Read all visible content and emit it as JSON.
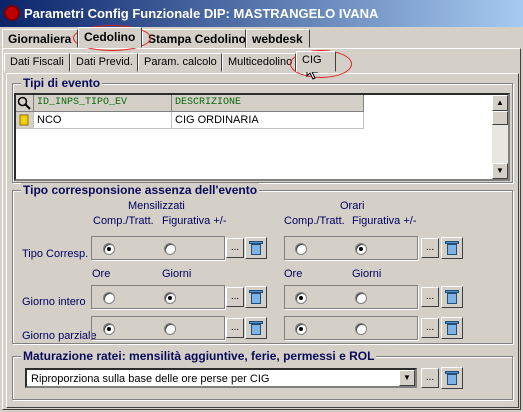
{
  "window": {
    "title": "Parametri Config Funzionale DIP: MASTRANGELO  IVANA"
  },
  "main_tabs": [
    {
      "label": "Giornaliera"
    },
    {
      "label": "Cedolino"
    },
    {
      "label": "Stampa Cedolino"
    },
    {
      "label": "webdesk"
    }
  ],
  "sub_tabs": [
    {
      "label": "Dati Fiscali"
    },
    {
      "label": "Dati Previd."
    },
    {
      "label": "Param. calcolo"
    },
    {
      "label": "Multicedolino"
    },
    {
      "label": "CIG"
    }
  ],
  "tipi_evento": {
    "title": "Tipi di evento",
    "columns": [
      "ID_INPS_TIPO_EV",
      "DESCRIZIONE"
    ],
    "rows": [
      [
        "NCO",
        "CIG ORDINARIA"
      ]
    ]
  },
  "assenza": {
    "title": "Tipo corresponsione assenza dell'evento",
    "mensilizzati": "Mensilizzati",
    "orari": "Orari",
    "comp_tratt": "Comp./Tratt.",
    "figurativa": "Figurativa +/-",
    "ore": "Ore",
    "giorni": "Giorni",
    "tipo_corresp": "Tipo Corresp.",
    "giorno_intero": "Giorno intero",
    "giorno_parziale": "Giorno parziale",
    "radios": {
      "tipo_corresp_m": [
        true,
        false
      ],
      "tipo_corresp_o": [
        false,
        true
      ],
      "intero_m": [
        false,
        true
      ],
      "intero_o": [
        true,
        false
      ],
      "parziale_m": [
        true,
        false
      ],
      "parziale_o": [
        true,
        false
      ]
    }
  },
  "maturazione": {
    "title": "Maturazione ratei: mensilità aggiuntive, ferie, permessi e ROL",
    "value": "Riproporziona sulla base delle ore perse per CIG"
  },
  "buttons": {
    "ellipsis": "..."
  },
  "colors": {
    "title_start": "#0a246a",
    "title_end": "#a6caf0",
    "annotation": "#e02020",
    "header_text": "#0a6a0a"
  }
}
